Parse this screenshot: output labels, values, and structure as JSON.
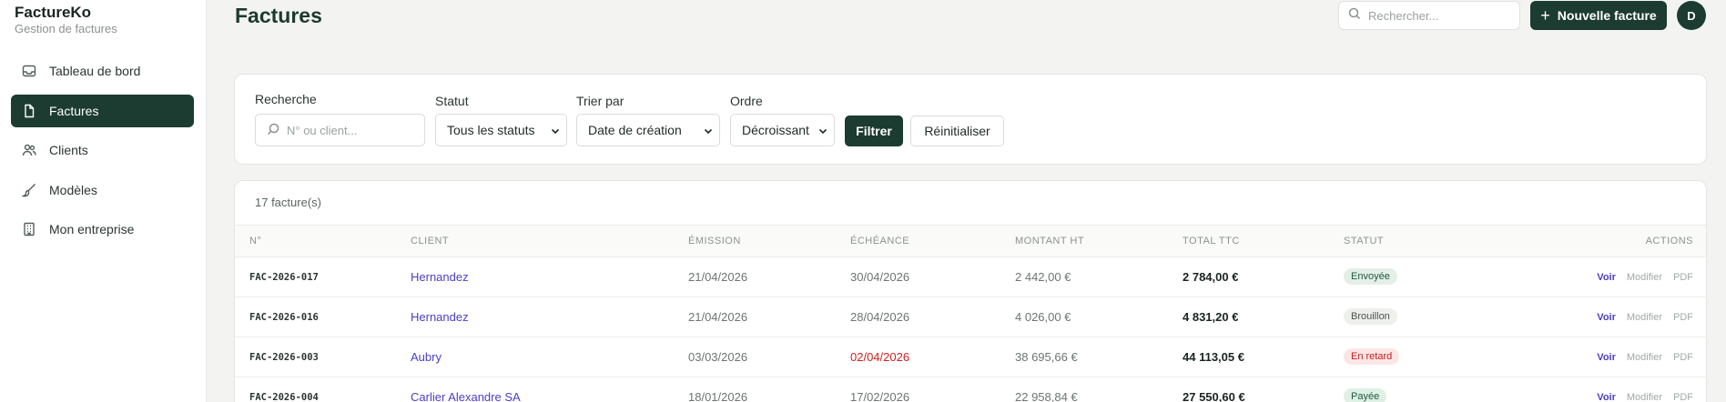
{
  "brand": {
    "name": "FactureKo",
    "subtitle": "Gestion de factures"
  },
  "sidebar": {
    "items": [
      {
        "label": "Tableau de bord",
        "icon": "inbox-icon",
        "active": false
      },
      {
        "label": "Factures",
        "icon": "file-icon",
        "active": true
      },
      {
        "label": "Clients",
        "icon": "users-icon",
        "active": false
      },
      {
        "label": "Modèles",
        "icon": "brush-icon",
        "active": false
      },
      {
        "label": "Mon entreprise",
        "icon": "building-icon",
        "active": false
      }
    ]
  },
  "header": {
    "title": "Factures",
    "search_placeholder": "Rechercher...",
    "new_button": "Nouvelle facture",
    "avatar_initial": "D"
  },
  "filters": {
    "search_label": "Recherche",
    "search_placeholder": "N° ou client...",
    "status_label": "Statut",
    "status_value": "Tous les statuts",
    "sort_label": "Trier par",
    "sort_value": "Date de création",
    "order_label": "Ordre",
    "order_value": "Décroissant",
    "filter_button": "Filtrer",
    "reset_button": "Réinitialiser"
  },
  "table": {
    "count": "17 facture(s)",
    "columns": [
      "N°",
      "CLIENT",
      "ÉMISSION",
      "ÉCHÉANCE",
      "MONTANT HT",
      "TOTAL TTC",
      "STATUT",
      "ACTIONS"
    ],
    "actions": {
      "view": "Voir",
      "edit": "Modifier",
      "pdf": "PDF"
    },
    "rows": [
      {
        "num": "FAC-2026-017",
        "client": "Hernandez",
        "issued": "21/04/2026",
        "due": "30/04/2026",
        "ht": "2 442,00 €",
        "ttc": "2 784,00 €",
        "status": "Envoyée",
        "overdue": false
      },
      {
        "num": "FAC-2026-016",
        "client": "Hernandez",
        "issued": "21/04/2026",
        "due": "28/04/2026",
        "ht": "4 026,00 €",
        "ttc": "4 831,20 €",
        "status": "Brouillon",
        "overdue": false
      },
      {
        "num": "FAC-2026-003",
        "client": "Aubry",
        "issued": "03/03/2026",
        "due": "02/04/2026",
        "ht": "38 695,66 €",
        "ttc": "44 113,05 €",
        "status": "En retard",
        "overdue": true
      },
      {
        "num": "FAC-2026-004",
        "client": "Carlier Alexandre SA",
        "issued": "18/01/2026",
        "due": "17/02/2026",
        "ht": "22 958,84 €",
        "ttc": "27 550,60 €",
        "status": "Payée",
        "overdue": false
      }
    ]
  },
  "colors": {
    "accent": "#1c3b31",
    "link": "#4a3fc6",
    "overdue": "#d32020",
    "badge_sent_bg": "#e3efe7",
    "badge_sent_fg": "#1f5a3e",
    "badge_draft_bg": "#eef0ec",
    "badge_draft_fg": "#4a524e",
    "badge_late_bg": "#fbe6e6",
    "badge_late_fg": "#c41f1f",
    "badge_paid_bg": "#dff0e4",
    "badge_paid_fg": "#1f5a3e"
  }
}
